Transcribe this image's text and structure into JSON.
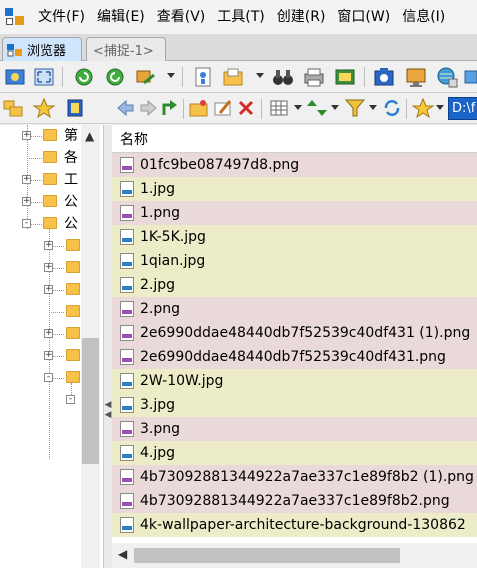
{
  "menu": [
    "文件(F)",
    "编辑(E)",
    "查看(V)",
    "工具(T)",
    "创建(R)",
    "窗口(W)",
    "信息(I)"
  ],
  "tabs": [
    {
      "label": "浏览器",
      "active": true
    },
    {
      "label": "<捕捉-1>",
      "active": false
    }
  ],
  "path": "D:\\f",
  "tree": {
    "nodes": [
      {
        "label": "第",
        "expander": "+"
      },
      {
        "label": "各",
        "expander": ""
      },
      {
        "label": "工",
        "expander": "+"
      },
      {
        "label": "公",
        "expander": "+"
      },
      {
        "label": "公",
        "expander": "-"
      }
    ],
    "child_expanders": [
      "+",
      "+",
      "+",
      "",
      "+",
      "+",
      "-",
      "-"
    ]
  },
  "list": {
    "column_header": "名称",
    "files": [
      {
        "name": "01fc9be087497d8.png",
        "type": "png"
      },
      {
        "name": "1.jpg",
        "type": "jpg"
      },
      {
        "name": "1.png",
        "type": "png"
      },
      {
        "name": "1K-5K.jpg",
        "type": "jpg"
      },
      {
        "name": "1qian.jpg",
        "type": "jpg"
      },
      {
        "name": "2.jpg",
        "type": "jpg"
      },
      {
        "name": "2.png",
        "type": "png"
      },
      {
        "name": "2e6990ddae48440db7f52539c40df431 (1).png",
        "type": "png"
      },
      {
        "name": "2e6990ddae48440db7f52539c40df431.png",
        "type": "png"
      },
      {
        "name": "2W-10W.jpg",
        "type": "jpg"
      },
      {
        "name": "3.jpg",
        "type": "jpg"
      },
      {
        "name": "3.png",
        "type": "png"
      },
      {
        "name": "4.jpg",
        "type": "jpg"
      },
      {
        "name": "4b73092881344922a7ae337c1e89f8b2 (1).png",
        "type": "png"
      },
      {
        "name": "4b73092881344922a7ae337c1e89f8b2.png",
        "type": "png"
      },
      {
        "name": "4k-wallpaper-architecture-background-130862",
        "type": "jpg"
      }
    ]
  },
  "colors": {
    "png_row": "#ead9d9",
    "jpg_row": "#ececc8",
    "accent": "#1a63c8"
  }
}
